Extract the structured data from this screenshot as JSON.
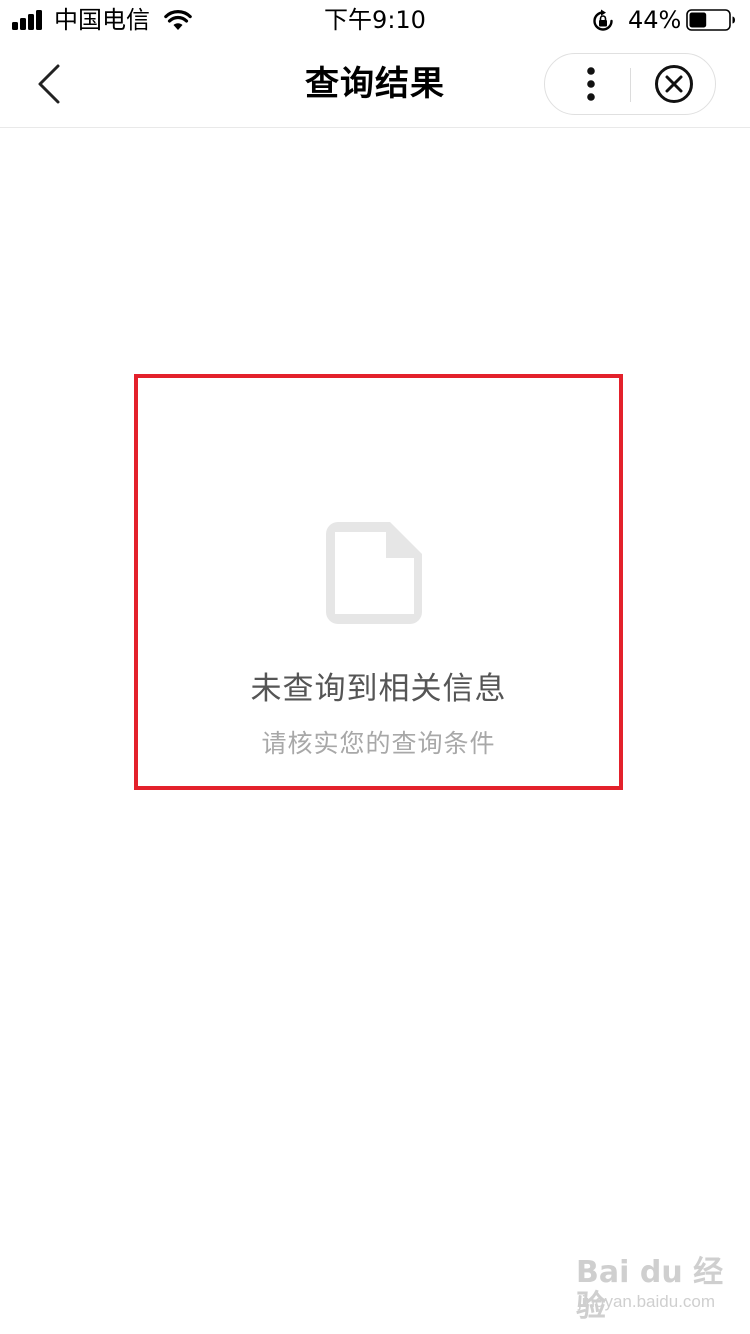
{
  "status_bar": {
    "carrier": "中国电信",
    "time": "下午9:10",
    "battery_percent": "44%",
    "battery_level": 0.44
  },
  "nav": {
    "title": "查询结果",
    "back_icon": "chevron-left-icon",
    "more_icon": "more-vertical-icon",
    "close_icon": "close-circle-icon"
  },
  "empty_state": {
    "icon": "document-icon",
    "title": "未查询到相关信息",
    "subtitle": "请核实您的查询条件"
  },
  "watermark": {
    "brand": "Bai du 经验",
    "url": "jingyan.baidu.com"
  },
  "colors": {
    "highlight": "#e3212b",
    "icon_gray": "#e6e6e6",
    "title_text": "#555555",
    "subtitle_text": "#a8a8a8"
  }
}
